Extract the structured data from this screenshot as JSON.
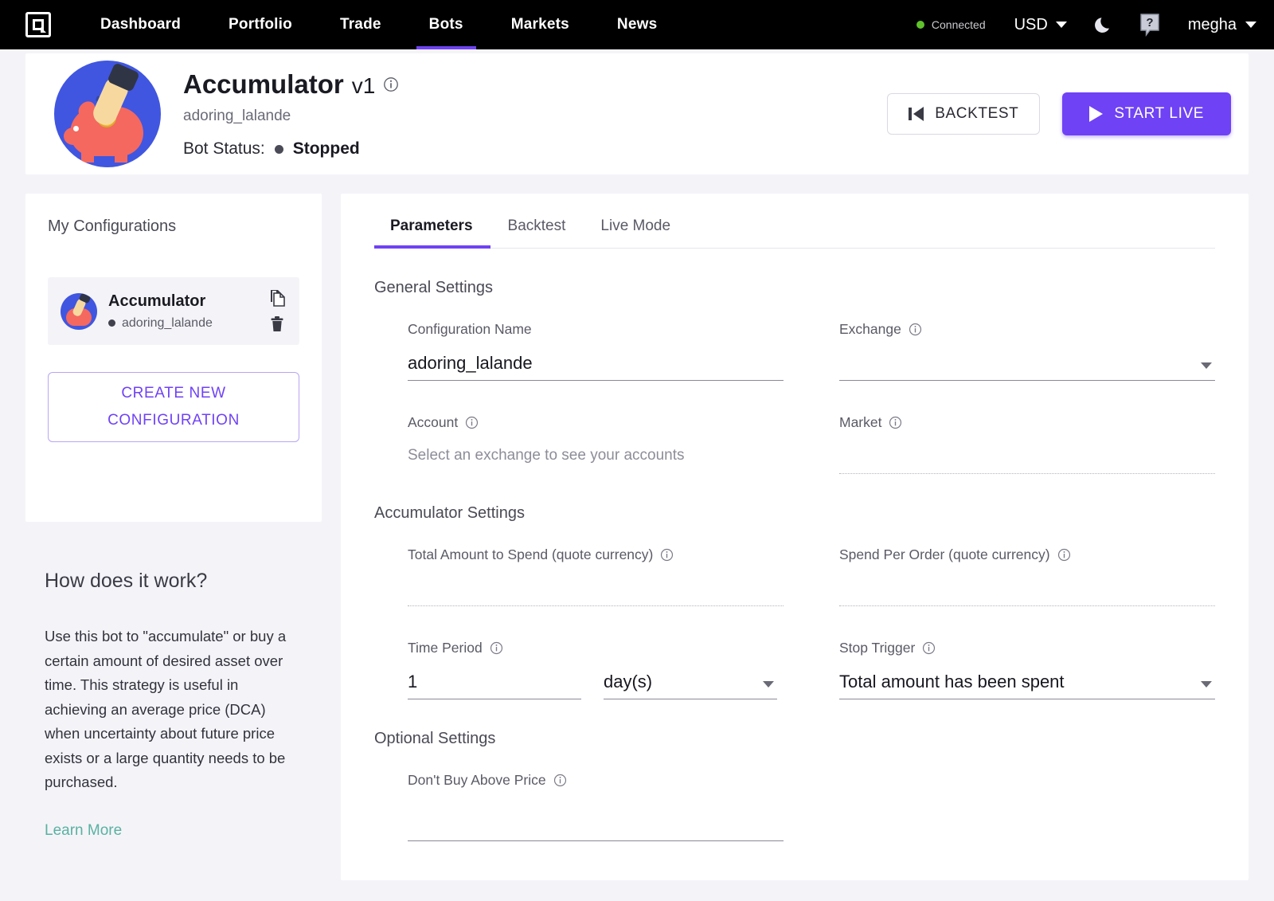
{
  "navbar": {
    "logo": "app-logo",
    "links": [
      {
        "label": "Dashboard",
        "active": false
      },
      {
        "label": "Portfolio",
        "active": false
      },
      {
        "label": "Trade",
        "active": false
      },
      {
        "label": "Bots",
        "active": true
      },
      {
        "label": "Markets",
        "active": false
      },
      {
        "label": "News",
        "active": false
      }
    ],
    "connection_status": "Connected",
    "connection_color": "#5fc22b",
    "currency": "USD",
    "theme_icon": "moon-icon",
    "help_icon": "question-help-icon",
    "username": "megha"
  },
  "bot_header": {
    "avatar_icon": "piggy-bank-avatar",
    "title": "Accumulator",
    "version": "v1",
    "info_icon": "info-icon",
    "subtitle": "adoring_lalande",
    "status_label": "Bot Status:",
    "status_value": "Stopped",
    "status_dot_color": "#4b4b57",
    "backtest_button": "BACKTEST",
    "start_live_button": "START LIVE",
    "accent_color": "#6f42f5"
  },
  "sidebar": {
    "title": "My Configurations",
    "configs": [
      {
        "name": "Accumulator",
        "slug": "adoring_lalande",
        "avatar_icon": "piggy-bank-avatar",
        "copy_icon": "copy-icon",
        "delete_icon": "trash-icon"
      }
    ],
    "create_button_line1": "CREATE NEW",
    "create_button_line2": "CONFIGURATION"
  },
  "how_panel": {
    "title": "How does it work?",
    "body": "Use this bot to \"accumulate\" or buy a certain amount of desired asset over time. This strategy is useful in achieving an average price (DCA) when uncertainty about future price exists or a large quantity needs to be purchased.",
    "link": "Learn More",
    "link_color": "#5ab1a2"
  },
  "tabs": [
    {
      "label": "Parameters",
      "active": true
    },
    {
      "label": "Backtest",
      "active": false
    },
    {
      "label": "Live Mode",
      "active": false
    }
  ],
  "general_settings": {
    "title": "General Settings",
    "configuration_name": {
      "label": "Configuration Name",
      "value": "adoring_lalande",
      "placeholder": ""
    },
    "exchange": {
      "label": "Exchange",
      "value": "",
      "placeholder": "",
      "info_icon": "info-icon",
      "caret_icon": "chevron-down-icon"
    },
    "account": {
      "label": "Account",
      "info_icon": "info-icon",
      "note": "Select an exchange to see your accounts"
    },
    "market": {
      "label": "Market",
      "value": "",
      "placeholder": "",
      "info_icon": "info-icon"
    }
  },
  "accumulator_settings": {
    "title": "Accumulator Settings",
    "total_amount": {
      "label": "Total Amount to Spend (quote currency)",
      "value": "",
      "info_icon": "info-icon"
    },
    "spend_per_order": {
      "label": "Spend Per Order (quote currency)",
      "value": "",
      "info_icon": "info-icon"
    },
    "time_period": {
      "label": "Time Period",
      "value": "1",
      "unit": "day(s)",
      "info_icon": "info-icon",
      "caret_icon": "chevron-down-icon"
    },
    "stop_trigger": {
      "label": "Stop Trigger",
      "value": "Total amount has been spent",
      "info_icon": "info-icon",
      "caret_icon": "chevron-down-icon"
    }
  },
  "optional_settings": {
    "title": "Optional Settings",
    "dont_buy_above": {
      "label": "Don't Buy Above Price",
      "value": "",
      "info_icon": "info-icon"
    }
  }
}
